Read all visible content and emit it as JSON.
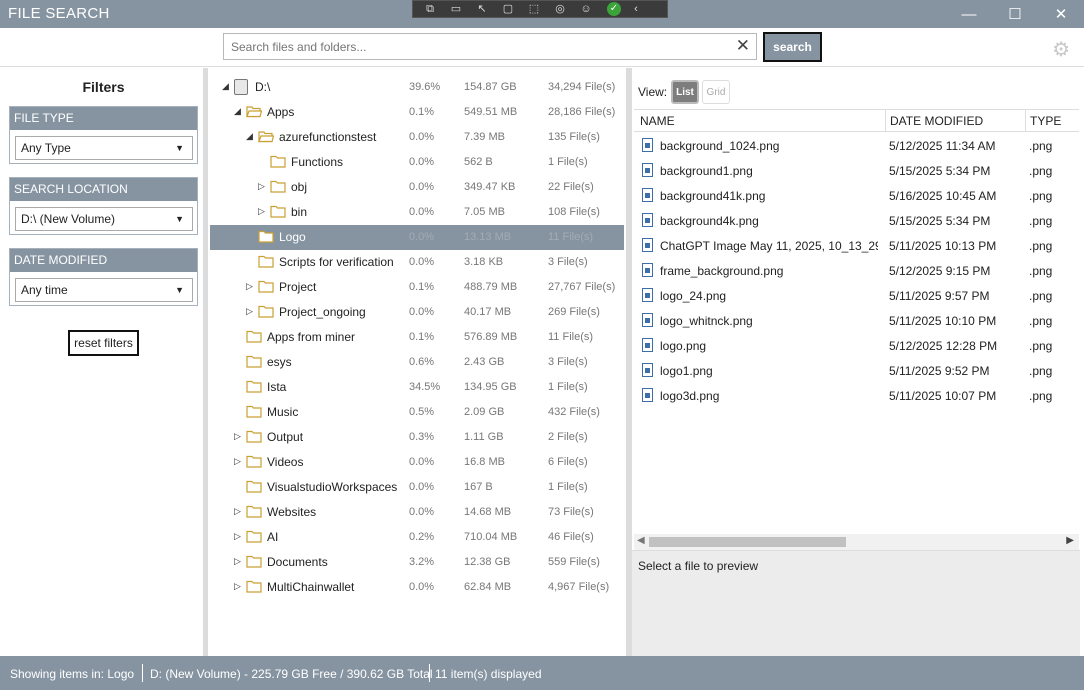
{
  "window": {
    "title": "FILE SEARCH",
    "minimize": "—",
    "maximize": "☐",
    "close": "✕"
  },
  "search": {
    "placeholder": "Search files and folders...",
    "value": "",
    "clear": "✕",
    "button": "search"
  },
  "filters": {
    "heading": "Filters",
    "file_type": {
      "label": "FILE TYPE",
      "value": "Any Type"
    },
    "search_location": {
      "label": "SEARCH LOCATION",
      "value": "D:\\ (New Volume)"
    },
    "date_modified": {
      "label": "DATE MODIFIED",
      "value": "Any time"
    },
    "reset": "reset filters"
  },
  "tree": [
    {
      "name": "D:\\",
      "pct": "39.6%",
      "size": "154.87 GB",
      "count": "34,294 File(s)",
      "depth": 0,
      "toggle": "expanded",
      "icon": "drive-icon"
    },
    {
      "name": "Apps",
      "pct": "0.1%",
      "size": "549.51 MB",
      "count": "28,186 File(s)",
      "depth": 1,
      "toggle": "expanded",
      "icon": "folder-open-icon"
    },
    {
      "name": "azurefunctionstest",
      "pct": "0.0%",
      "size": "7.39 MB",
      "count": "135 File(s)",
      "depth": 2,
      "toggle": "expanded",
      "icon": "folder-open-icon"
    },
    {
      "name": "Functions",
      "pct": "0.0%",
      "size": "562 B",
      "count": "1 File(s)",
      "depth": 3,
      "toggle": "none",
      "icon": "folder-icon"
    },
    {
      "name": "obj",
      "pct": "0.0%",
      "size": "349.47 KB",
      "count": "22 File(s)",
      "depth": 3,
      "toggle": "collapsed",
      "icon": "folder-icon"
    },
    {
      "name": "bin",
      "pct": "0.0%",
      "size": "7.05 MB",
      "count": "108 File(s)",
      "depth": 3,
      "toggle": "collapsed",
      "icon": "folder-icon"
    },
    {
      "name": "Logo",
      "pct": "0.0%",
      "size": "13.13 MB",
      "count": "11 File(s)",
      "depth": 2,
      "toggle": "none",
      "icon": "folder-icon",
      "selected": true
    },
    {
      "name": "Scripts for verification",
      "pct": "0.0%",
      "size": "3.18 KB",
      "count": "3 File(s)",
      "depth": 2,
      "toggle": "none",
      "icon": "folder-icon"
    },
    {
      "name": "Project",
      "pct": "0.1%",
      "size": "488.79 MB",
      "count": "27,767 File(s)",
      "depth": 2,
      "toggle": "collapsed",
      "icon": "folder-icon"
    },
    {
      "name": "Project_ongoing",
      "pct": "0.0%",
      "size": "40.17 MB",
      "count": "269 File(s)",
      "depth": 2,
      "toggle": "collapsed",
      "icon": "folder-icon"
    },
    {
      "name": "Apps from miner",
      "pct": "0.1%",
      "size": "576.89 MB",
      "count": "11 File(s)",
      "depth": 1,
      "toggle": "none",
      "icon": "folder-icon"
    },
    {
      "name": "esys",
      "pct": "0.6%",
      "size": "2.43 GB",
      "count": "3 File(s)",
      "depth": 1,
      "toggle": "none",
      "icon": "folder-icon"
    },
    {
      "name": "Ista",
      "pct": "34.5%",
      "size": "134.95 GB",
      "count": "1 File(s)",
      "depth": 1,
      "toggle": "none",
      "icon": "folder-icon"
    },
    {
      "name": "Music",
      "pct": "0.5%",
      "size": "2.09 GB",
      "count": "432 File(s)",
      "depth": 1,
      "toggle": "none",
      "icon": "folder-icon"
    },
    {
      "name": "Output",
      "pct": "0.3%",
      "size": "1.11 GB",
      "count": "2 File(s)",
      "depth": 1,
      "toggle": "collapsed",
      "icon": "folder-icon"
    },
    {
      "name": "Videos",
      "pct": "0.0%",
      "size": "16.8 MB",
      "count": "6 File(s)",
      "depth": 1,
      "toggle": "collapsed",
      "icon": "folder-icon"
    },
    {
      "name": "VisualstudioWorkspaces",
      "pct": "0.0%",
      "size": "167 B",
      "count": "1 File(s)",
      "depth": 1,
      "toggle": "none",
      "icon": "folder-icon"
    },
    {
      "name": "Websites",
      "pct": "0.0%",
      "size": "14.68 MB",
      "count": "73 File(s)",
      "depth": 1,
      "toggle": "collapsed",
      "icon": "folder-icon"
    },
    {
      "name": "AI",
      "pct": "0.2%",
      "size": "710.04 MB",
      "count": "46 File(s)",
      "depth": 1,
      "toggle": "collapsed",
      "icon": "folder-icon"
    },
    {
      "name": "Documents",
      "pct": "3.2%",
      "size": "12.38 GB",
      "count": "559 File(s)",
      "depth": 1,
      "toggle": "collapsed",
      "icon": "folder-icon"
    },
    {
      "name": "MultiChainwallet",
      "pct": "0.0%",
      "size": "62.84 MB",
      "count": "4,967 File(s)",
      "depth": 1,
      "toggle": "collapsed",
      "icon": "folder-icon"
    }
  ],
  "view": {
    "label": "View:",
    "list": "List",
    "grid": "Grid",
    "active": "list"
  },
  "files": {
    "columns": {
      "name": "NAME",
      "date": "DATE MODIFIED",
      "type": "TYPE"
    },
    "rows": [
      {
        "name": "background_1024.png",
        "date": "5/12/2025 11:34 AM",
        "type": ".png"
      },
      {
        "name": "background1.png",
        "date": "5/15/2025 5:34 PM",
        "type": ".png"
      },
      {
        "name": "background41k.png",
        "date": "5/16/2025 10:45 AM",
        "type": ".png"
      },
      {
        "name": "background4k.png",
        "date": "5/15/2025 5:34 PM",
        "type": ".png"
      },
      {
        "name": "ChatGPT Image May 11, 2025, 10_13_29 PM.png",
        "date": "5/11/2025 10:13 PM",
        "type": ".png"
      },
      {
        "name": "frame_background.png",
        "date": "5/12/2025 9:15 PM",
        "type": ".png"
      },
      {
        "name": "logo_24.png",
        "date": "5/11/2025 9:57 PM",
        "type": ".png"
      },
      {
        "name": "logo_whitnck.png",
        "date": "5/11/2025 10:10 PM",
        "type": ".png"
      },
      {
        "name": "logo.png",
        "date": "5/12/2025 12:28 PM",
        "type": ".png"
      },
      {
        "name": "logo1.png",
        "date": "5/11/2025 9:52 PM",
        "type": ".png"
      },
      {
        "name": "logo3d.png",
        "date": "5/11/2025 10:07 PM",
        "type": ".png"
      }
    ]
  },
  "preview": {
    "text": "Select a file to preview"
  },
  "status": {
    "location": "Showing items in: Logo",
    "drive": "D: (New Volume) - 225.79 GB Free / 390.62 GB Total",
    "count": "11 item(s) displayed"
  },
  "colors": {
    "accent": "#8694a2",
    "folder": "#c9a034",
    "file_icon": "#3d6ea7"
  }
}
